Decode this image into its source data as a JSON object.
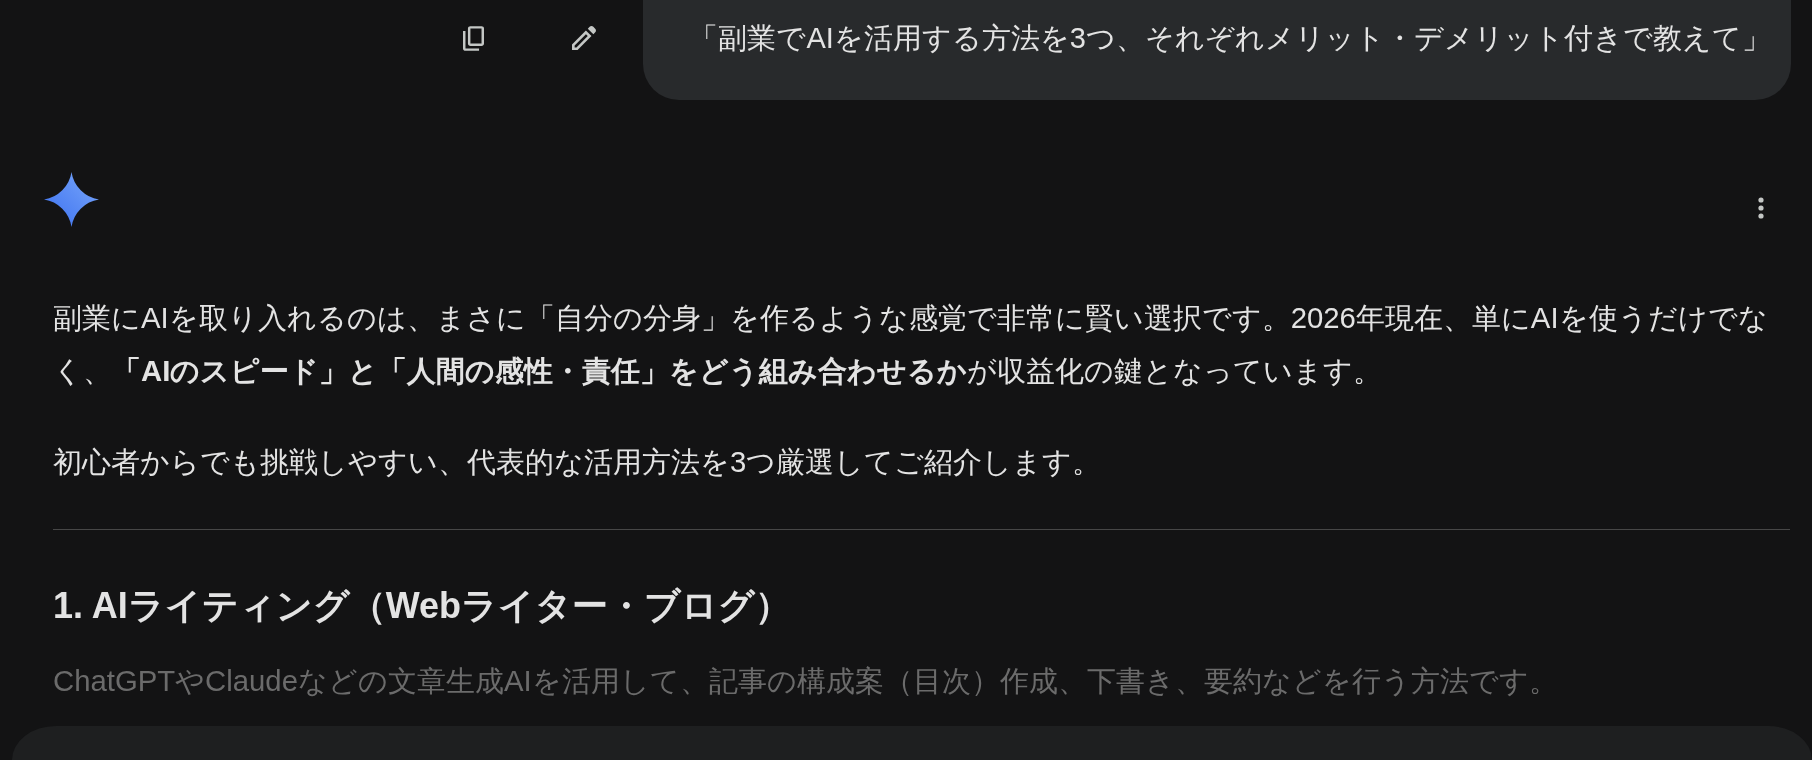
{
  "user_message": {
    "text": "「副業でAIを活用する方法を3つ、それぞれメリット・デメリット付きで教えて」"
  },
  "response": {
    "blocks": [
      {
        "kind": "paragraph",
        "faded": false,
        "text": "副業にAIを取り入れるのは、まさに「自分の分身」を作るような感覚で非常に賢い選択です。2026年現在、単にAIを使うだけでなく、**「AIのスピード」と「人間の感性・責任」をどう組み合わせるか**が収益化の鍵となっています。"
      },
      {
        "kind": "paragraph",
        "faded": false,
        "text": "初心者からでも挑戦しやすい、代表的な活用方法を3つ厳選してご紹介します。"
      },
      {
        "kind": "divider",
        "faded": false
      },
      {
        "kind": "heading",
        "faded": false,
        "text": "1. AIライティング（Webライター・ブログ）"
      },
      {
        "kind": "paragraph",
        "faded": true,
        "text": "ChatGPTやClaudeなどの文章生成AIを活用して、記事の構成案（目次）作成、下書き、要約などを行う方法です。"
      }
    ]
  }
}
